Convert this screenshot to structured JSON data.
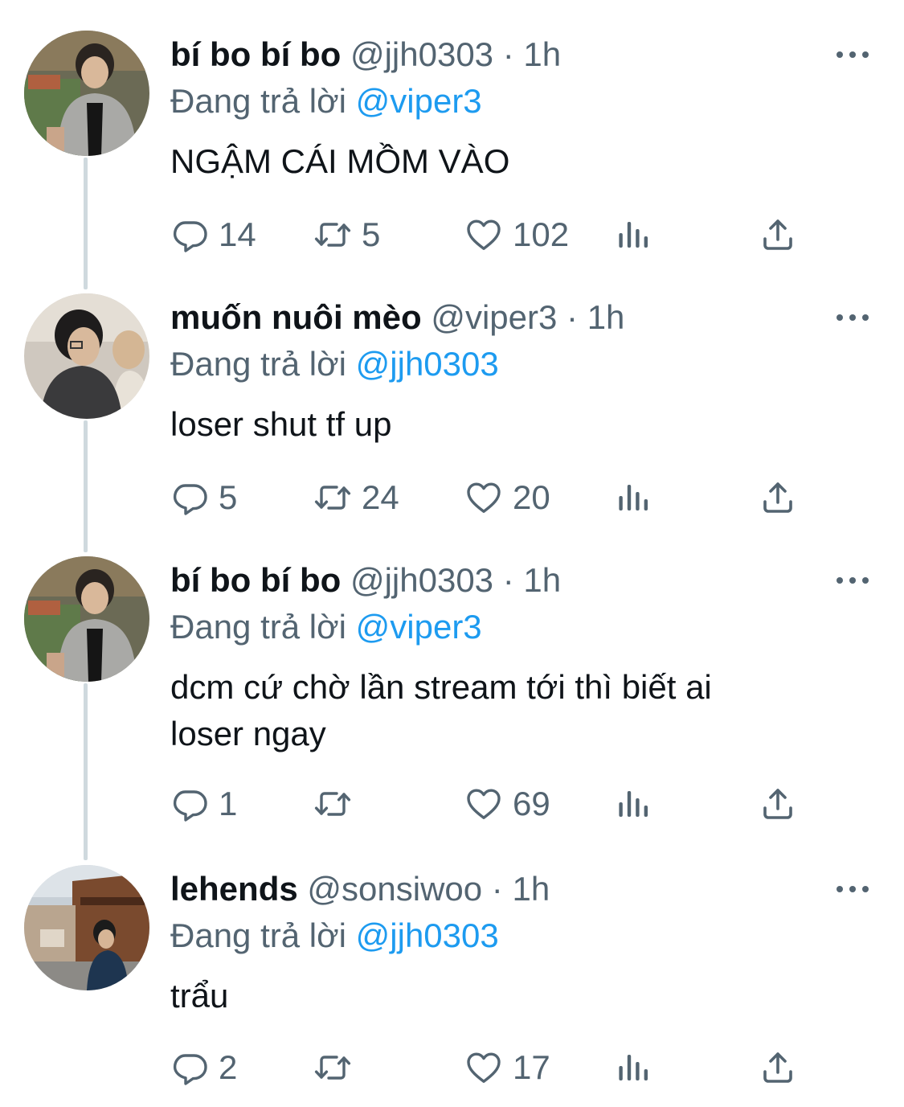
{
  "replying_prefix": "Đang trả lời",
  "tweets": [
    {
      "name": "bí bo bí bo",
      "handle": "@jjh0303",
      "separator": "·",
      "time": "1h",
      "reply_to": "@viper3",
      "text": "NGẬM CÁI MỒM VÀO",
      "replies": "14",
      "retweets": "5",
      "likes": "102"
    },
    {
      "name": "muốn nuôi mèo",
      "handle": "@viper3",
      "separator": "·",
      "time": "1h",
      "reply_to": "@jjh0303",
      "text": "loser shut tf up",
      "replies": "5",
      "retweets": "24",
      "likes": "20"
    },
    {
      "name": "bí bo bí bo",
      "handle": "@jjh0303",
      "separator": "·",
      "time": "1h",
      "reply_to": "@viper3",
      "text_line1": "dcm cứ chờ lần stream tới thì biết ai",
      "text_line2": "loser ngay",
      "replies": "1",
      "retweets": "",
      "likes": "69"
    },
    {
      "name": "lehends",
      "handle": "@sonsiwoo",
      "separator": "·",
      "time": "1h",
      "reply_to": "@jjh0303",
      "text": "trẩu",
      "replies": "2",
      "retweets": "",
      "likes": "17"
    }
  ],
  "icons": {
    "reply": "reply-icon",
    "retweet": "retweet-icon",
    "like": "heart-icon",
    "views": "analytics-icon",
    "share": "share-icon",
    "more": "more-icon"
  },
  "colors": {
    "text": "#0f1419",
    "secondary": "#536471",
    "link": "#1d9bf0",
    "thread_line": "#cfd9de"
  }
}
